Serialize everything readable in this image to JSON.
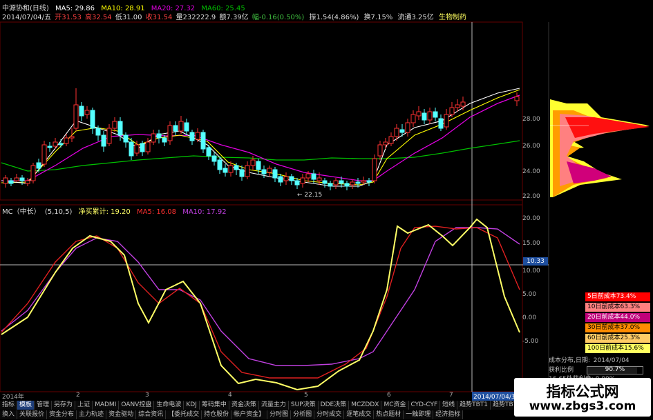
{
  "header": {
    "stock_title": "中源协和(日线)",
    "ma5_label": "MA5: 29.86",
    "ma10_label": "MA10: 28.91",
    "ma20_label": "MA20: 27.32",
    "ma60_label": "MA60: 25.45",
    "date": "2014/07/04/五",
    "open": "开31.53",
    "high": "高32.54",
    "low": "低31.00",
    "close": "收31.54",
    "volume": "量232222.9",
    "amount": "额7.39亿",
    "change_pct": "幅-0.16(0.50%)",
    "amplitude": "振1.54(4.86%)",
    "turnover": "换7.15%",
    "float_shares": "流通3.25亿",
    "sector": "生物制药"
  },
  "indicator": {
    "name": "MC（中长）",
    "params": "(5,10,5)",
    "value_label": "净买累计: 19.20",
    "ma5_label": "MA5: 16.08",
    "ma10_label": "MA10: 17.92"
  },
  "price_axis": [
    "28.00",
    "26.00",
    "24.00",
    "22.00"
  ],
  "indicator_axis": [
    "20.00",
    "15.00",
    "10.00",
    "5.00",
    "0.00",
    "-5.00"
  ],
  "crosshair_value": "10.33",
  "low_marker": "22.15",
  "cost_box": [
    {
      "label": "5日前成本73.4%",
      "bg": "#ff0000",
      "fg": "#ffffff"
    },
    {
      "label": "10日前成本63.3%",
      "bg": "#ff8080",
      "fg": "#000000"
    },
    {
      "label": "20日前成本44.0%",
      "bg": "#c0007a",
      "fg": "#ffffff"
    },
    {
      "label": "30日前成本37.0%",
      "bg": "#ff8c00",
      "fg": "#000000"
    },
    {
      "label": "60日前成本25.3%",
      "bg": "#ffcc66",
      "fg": "#000000"
    },
    {
      "label": "100日前成本15.6%",
      "bg": "#ffff60",
      "fg": "#000000"
    }
  ],
  "cost_info": {
    "dist_label": "成本分布,日期:",
    "dist_date": "2014/07/04",
    "profit_label": "获利比例",
    "profit_value": "90.7%",
    "extra_label": "16.65处获利盘:",
    "extra_value": "0.00%"
  },
  "timeline": {
    "year_label": "2014年",
    "months": [
      "2",
      "3",
      "4",
      "5",
      "6",
      "7"
    ],
    "cursor_date": "2014/07/04/五"
  },
  "toolbar_row1": [
    "指标",
    "模板",
    "管理",
    "另存为",
    "上证",
    "MADMI",
    "OANV控盘",
    "生命电波",
    "KDJ",
    "筹码集中",
    "资金决策",
    "流量主力",
    "SUP决策",
    "DDE决策",
    "MCZDDX",
    "MC资金",
    "CYD-CYF",
    "短线",
    "趋势TBT1",
    "趋势TBT2",
    "行业IC1",
    "行业IC2"
  ],
  "toolbar_row2": [
    "换入",
    "关联报价",
    "资金分布",
    "主力轨迹",
    "资金驱动",
    "综合资讯",
    "【委托成交",
    "持仓股份",
    "帐户资金】",
    "分时图",
    "分析图",
    "分时成交",
    "逐笔成交",
    "热点题材",
    "一触即理",
    "经济指标"
  ],
  "watermark": {
    "line1": "指标公式网",
    "line2": "www.zbgs3.com"
  },
  "colors": {
    "up": "#ff3232",
    "down": "#54ffff",
    "ma5": "#ffffff",
    "ma10": "#ffff00",
    "ma20": "#e000e0",
    "ma60": "#00c000",
    "mc_line": "#ffff66",
    "mc_ma5": "#e02020",
    "mc_ma10": "#c040e0"
  }
}
